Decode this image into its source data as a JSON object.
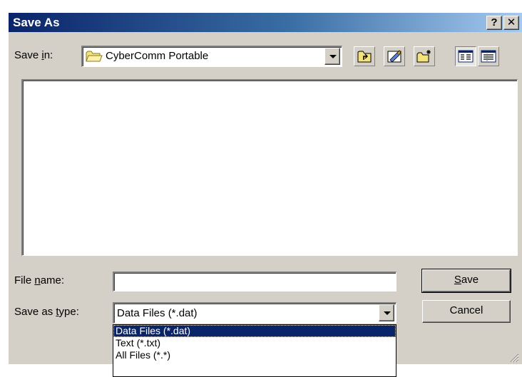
{
  "window": {
    "title": "Save As",
    "help_glyph": "?",
    "close_glyph": "✕"
  },
  "save_in": {
    "label_pre": "Save ",
    "label_key": "i",
    "label_post": "n:",
    "value": "CyberComm Portable"
  },
  "toolbar": {
    "icons": [
      "up-one-level-icon",
      "desktop-icon",
      "new-folder-icon",
      "list-view-icon",
      "details-view-icon"
    ]
  },
  "file_name": {
    "label_pre": "File ",
    "label_key": "n",
    "label_post": "ame:",
    "value": ""
  },
  "save_as_type": {
    "label_pre": "Save as ",
    "label_key": "t",
    "label_post": "ype:",
    "value": "Data Files (*.dat)",
    "options": [
      "Data Files (*.dat)",
      "Text (*.txt)",
      "All Files (*.*)"
    ],
    "selected_index": 0
  },
  "buttons": {
    "save_key": "S",
    "save_rest": "ave",
    "cancel": "Cancel"
  }
}
